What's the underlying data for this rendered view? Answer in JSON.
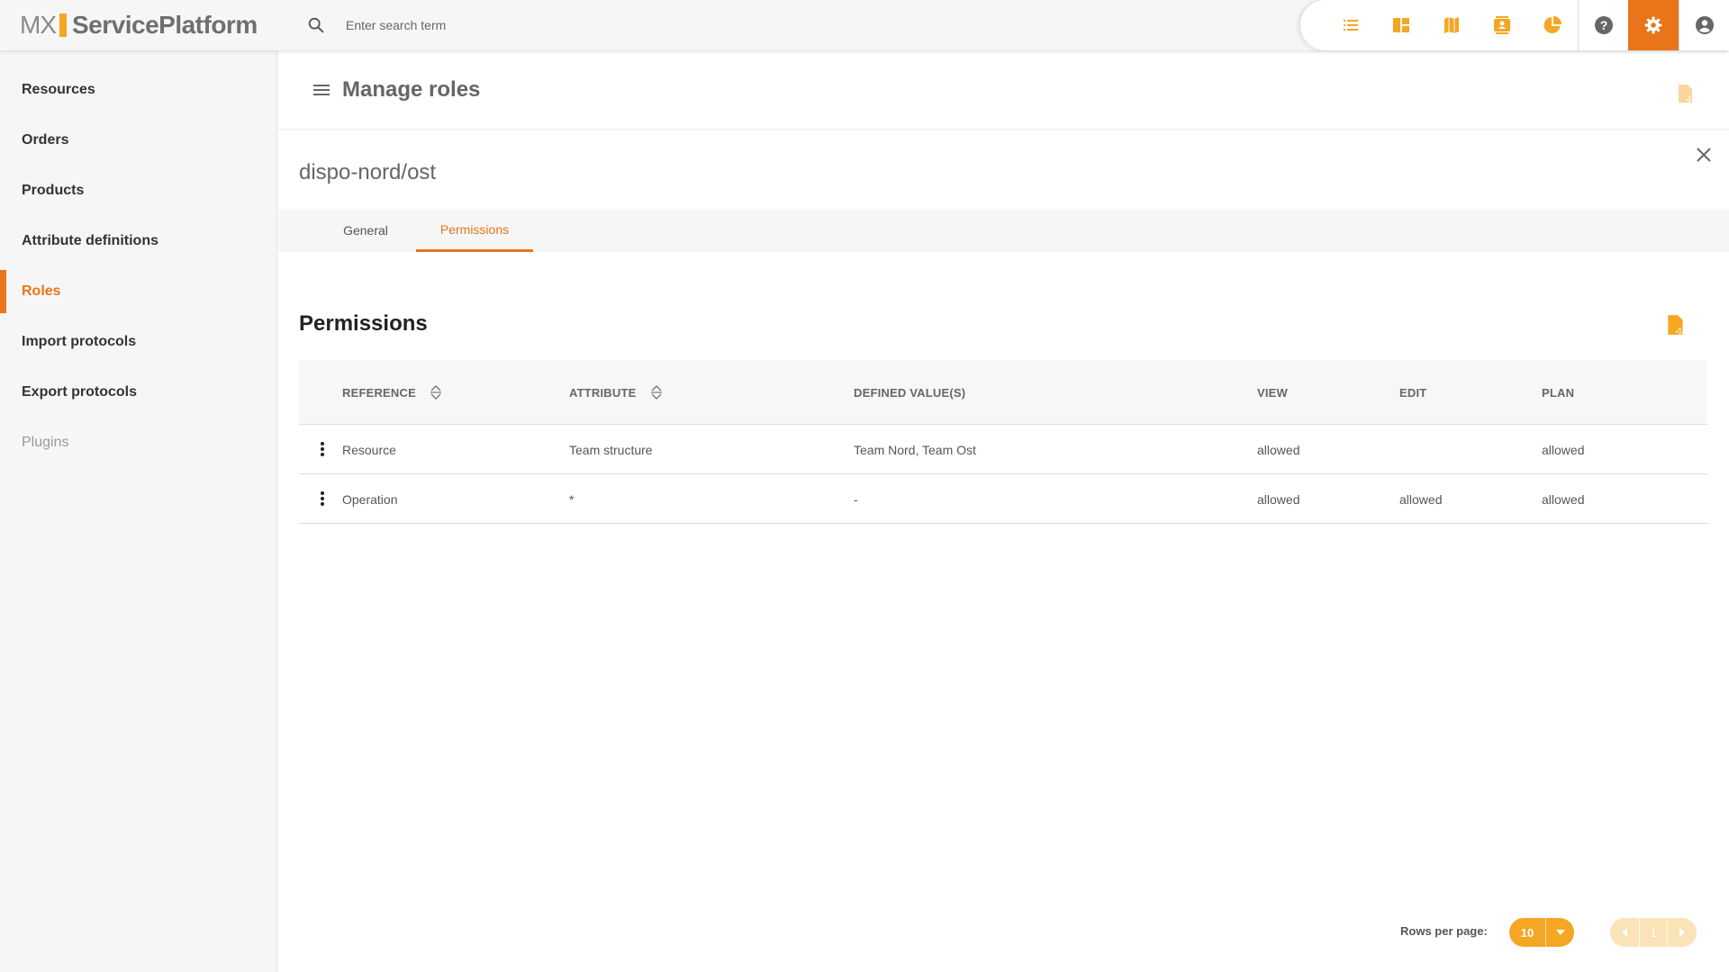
{
  "app": {
    "logo_mx": "MX",
    "logo_name": "ServicePlatform",
    "search_placeholder": "Enter search term"
  },
  "toolbar": {
    "icons": [
      "list-icon",
      "dashboard-icon",
      "map-icon",
      "contacts-icon",
      "pie-chart-icon",
      "help-icon",
      "settings-icon",
      "account-icon"
    ],
    "active": "settings-icon",
    "accent": "#e8751a",
    "icon_color": "#f5a623"
  },
  "sidebar": {
    "items": [
      {
        "label": "Resources",
        "state": "normal"
      },
      {
        "label": "Orders",
        "state": "normal"
      },
      {
        "label": "Products",
        "state": "normal"
      },
      {
        "label": "Attribute definitions",
        "state": "normal"
      },
      {
        "label": "Roles",
        "state": "active"
      },
      {
        "label": "Import protocols",
        "state": "normal"
      },
      {
        "label": "Export protocols",
        "state": "normal"
      },
      {
        "label": "Plugins",
        "state": "disabled"
      }
    ]
  },
  "header": {
    "title": "Manage roles"
  },
  "role": {
    "name": "dispo-nord/ost"
  },
  "tabs": [
    {
      "label": "General",
      "active": false
    },
    {
      "label": "Permissions",
      "active": true
    }
  ],
  "permissions": {
    "title": "Permissions",
    "columns": [
      "REFERENCE",
      "ATTRIBUTE",
      "DEFINED VALUE(S)",
      "VIEW",
      "EDIT",
      "PLAN"
    ],
    "rows": [
      {
        "reference": "Resource",
        "attribute": "Team structure",
        "values": "Team Nord, Team Ost",
        "view": "allowed",
        "edit": "",
        "plan": "allowed"
      },
      {
        "reference": "Operation",
        "attribute": "*",
        "values": "-",
        "view": "allowed",
        "edit": "allowed",
        "plan": "allowed"
      }
    ]
  },
  "pagination": {
    "rows_per_page_label": "Rows per page:",
    "rows_per_page": "10",
    "page": "1"
  }
}
